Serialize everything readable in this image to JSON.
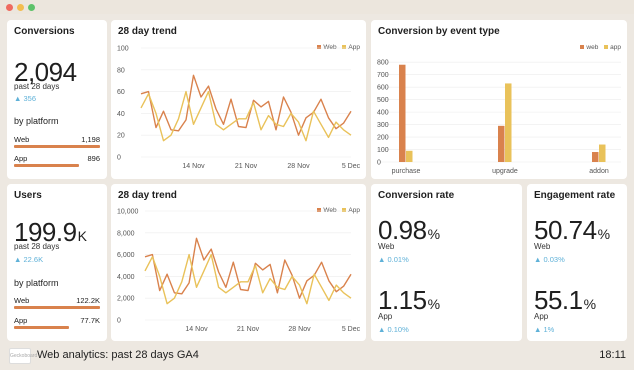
{
  "colors": {
    "web": "#d9824d",
    "app": "#e9c25a",
    "delta": "#5fb1d8",
    "grid": "#ececec"
  },
  "conversions": {
    "title": "Conversions",
    "value": "2,094",
    "period": "past 28 days",
    "delta": "▲ 356",
    "by_platform": "by platform",
    "web_label": "Web",
    "web_value": "1,198",
    "web_share": 1.0,
    "app_label": "App",
    "app_value": "896",
    "app_share": 0.75
  },
  "users": {
    "title": "Users",
    "value": "199.9",
    "unit": "K",
    "period": "past 28 days",
    "delta": "▲ 22.6K",
    "by_platform": "by platform",
    "web_label": "Web",
    "web_value": "122.2K",
    "web_share": 1.0,
    "app_label": "App",
    "app_value": "77.7K",
    "app_share": 0.64
  },
  "trend1": {
    "title": "28 day trend",
    "legend_web": "Web",
    "legend_app": "App"
  },
  "trend2": {
    "title": "28 day trend",
    "legend_web": "Web",
    "legend_app": "App"
  },
  "event_type": {
    "title": "Conversion by event type",
    "legend_web": "web",
    "legend_app": "app"
  },
  "conversion_rate": {
    "title": "Conversion rate",
    "web_value": "0.98",
    "web_unit": "%",
    "web_label": "Web",
    "web_delta": "▲ 0.01%",
    "app_value": "1.15",
    "app_unit": "%",
    "app_label": "App",
    "app_delta": "▲ 0.10%"
  },
  "engagement_rate": {
    "title": "Engagement rate",
    "web_value": "50.74",
    "web_unit": "%",
    "web_label": "Web",
    "web_delta": "▲ 0.03%",
    "app_value": "55.1",
    "app_unit": "%",
    "app_label": "App",
    "app_delta": "▲ 1%"
  },
  "footer": {
    "logo": "Geckoboard",
    "title": "Web analytics: past 28 days GA4",
    "time": "18:11"
  },
  "chart_data": [
    {
      "type": "line",
      "x_ticks": [
        "14 Nov",
        "21 Nov",
        "28 Nov",
        "5 Dec"
      ],
      "x_tick_index": [
        7,
        14,
        21,
        28
      ],
      "y_ticks": [
        0,
        20,
        40,
        60,
        80,
        100
      ],
      "ylim": [
        0,
        100
      ],
      "series": [
        {
          "name": "Web",
          "values": [
            58,
            60,
            27,
            42,
            25,
            24,
            34,
            75,
            55,
            65,
            44,
            30,
            53,
            28,
            27,
            52,
            46,
            51,
            25,
            55,
            41,
            20,
            36,
            41,
            53,
            36,
            26,
            31,
            42
          ]
        },
        {
          "name": "App",
          "values": [
            45,
            58,
            40,
            15,
            20,
            35,
            60,
            30,
            45,
            60,
            30,
            25,
            30,
            35,
            35,
            50,
            25,
            38,
            30,
            28,
            40,
            32,
            15,
            42,
            30,
            18,
            32,
            25,
            20
          ]
        }
      ]
    },
    {
      "type": "bar",
      "categories": [
        "purchase",
        "upgrade",
        "addon"
      ],
      "series": [
        {
          "name": "web",
          "values": [
            780,
            290,
            80
          ]
        },
        {
          "name": "app",
          "values": [
            90,
            630,
            140
          ]
        }
      ],
      "y_ticks": [
        0,
        100,
        200,
        300,
        400,
        500,
        600,
        700,
        800
      ],
      "ylim": [
        0,
        850
      ]
    },
    {
      "type": "line",
      "x_ticks": [
        "14 Nov",
        "21 Nov",
        "28 Nov",
        "5 Dec"
      ],
      "x_tick_index": [
        7,
        14,
        21,
        28
      ],
      "y_ticks": [
        "0",
        "2,000",
        "4,000",
        "6,000",
        "8,000",
        "10,000"
      ],
      "ylim": [
        0,
        10000
      ],
      "series": [
        {
          "name": "Web",
          "values": [
            5800,
            6000,
            2700,
            4200,
            2500,
            2400,
            3400,
            7500,
            5500,
            6500,
            4400,
            3000,
            5300,
            2800,
            2700,
            5200,
            4600,
            5100,
            2500,
            5500,
            4100,
            2000,
            3600,
            4100,
            5300,
            3600,
            2600,
            3100,
            4200
          ]
        },
        {
          "name": "App",
          "values": [
            4500,
            5800,
            4000,
            1500,
            2000,
            3500,
            6000,
            3000,
            4500,
            6000,
            3000,
            2500,
            3000,
            3500,
            3500,
            5000,
            2500,
            3800,
            3000,
            2800,
            4000,
            3200,
            1500,
            4200,
            3000,
            1800,
            3200,
            2500,
            2000
          ]
        }
      ]
    }
  ]
}
